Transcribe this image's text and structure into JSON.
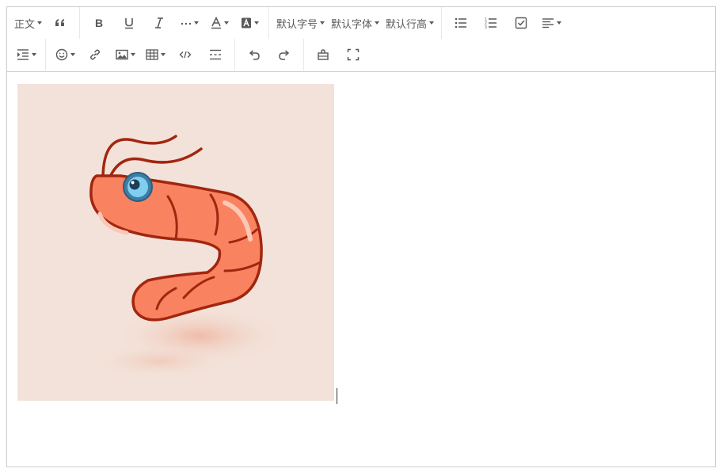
{
  "toolbar": {
    "row1": {
      "header": {
        "label": "正文"
      },
      "blockquote_icon": "blockquote-icon",
      "bold_icon": "bold-icon",
      "underline_icon": "underline-icon",
      "italic_icon": "italic-icon",
      "more_icon": "more-icon",
      "color_icon": "font-color-icon",
      "bgcolor_icon": "bg-color-icon",
      "font_size": {
        "label": "默认字号"
      },
      "font_family": {
        "label": "默认字体"
      },
      "line_height": {
        "label": "默认行高"
      },
      "bulleted_list_icon": "bulleted-list-icon",
      "numbered_list_icon": "numbered-list-icon",
      "todo_icon": "todo-icon",
      "align_icon": "justify-icon"
    },
    "row2": {
      "indent_icon": "indent-icon",
      "emotion_icon": "emotion-icon",
      "link_icon": "link-icon",
      "image_icon": "image-icon",
      "table_icon": "table-icon",
      "code_icon": "code-icon",
      "divider_icon": "divider-icon",
      "undo_icon": "undo-icon",
      "redo_icon": "redo-icon",
      "clear_icon": "clear-format-icon",
      "fullscreen_icon": "fullscreen-icon"
    }
  },
  "content": {
    "image": {
      "subject": "shrimp-illustration"
    }
  },
  "colors": {
    "border": "#cccccc",
    "icon": "#595959",
    "image_bg": "#f3e2d9",
    "shrimp_body": "#f98361",
    "shrimp_outline": "#a2260f",
    "eye_outer": "#3d7ea6",
    "eye_iris": "#7fd0f0"
  }
}
